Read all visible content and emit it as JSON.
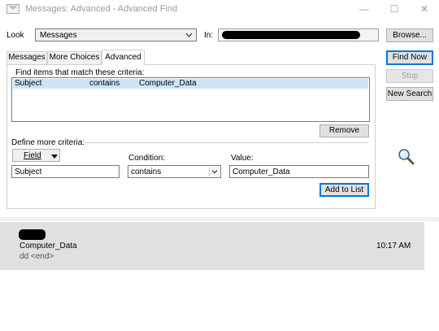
{
  "window": {
    "title": "Messages: Advanced - Advanced Find",
    "minimize_glyph": "—",
    "maximize_glyph": "☐",
    "close_glyph": "✕"
  },
  "look": {
    "label": "Look",
    "value": "Messages",
    "in_label": "In:"
  },
  "buttons": {
    "browse": "Browse...",
    "find_now": "Find Now",
    "stop": "Stop",
    "new_search": "New Search",
    "remove": "Remove",
    "add_to_list": "Add to List"
  },
  "tabs": [
    {
      "label": "Messages",
      "active": false
    },
    {
      "label": "More Choices",
      "active": false
    },
    {
      "label": "Advanced",
      "active": true
    }
  ],
  "criteria": {
    "heading": "Find items that match these criteria:",
    "rows": [
      {
        "field": "Subject",
        "condition": "contains",
        "value": "Computer_Data",
        "selected": true
      }
    ]
  },
  "define": {
    "heading": "Define more criteria:",
    "field_button": "Field",
    "condition_label": "Condition:",
    "value_label": "Value:",
    "field_value": "Subject",
    "condition_value": "contains",
    "value_value": "Computer_Data"
  },
  "results": [
    {
      "subject": "Computer_Data",
      "preview": "dd <end>",
      "time": "10:17 AM"
    }
  ],
  "icons": {
    "search": "magnifier-icon",
    "dropdown": "chevron-down-icon"
  },
  "colors": {
    "selection": "#cce4f7",
    "default_button_border": "#0078d7",
    "result_background": "#e0e0e0"
  }
}
